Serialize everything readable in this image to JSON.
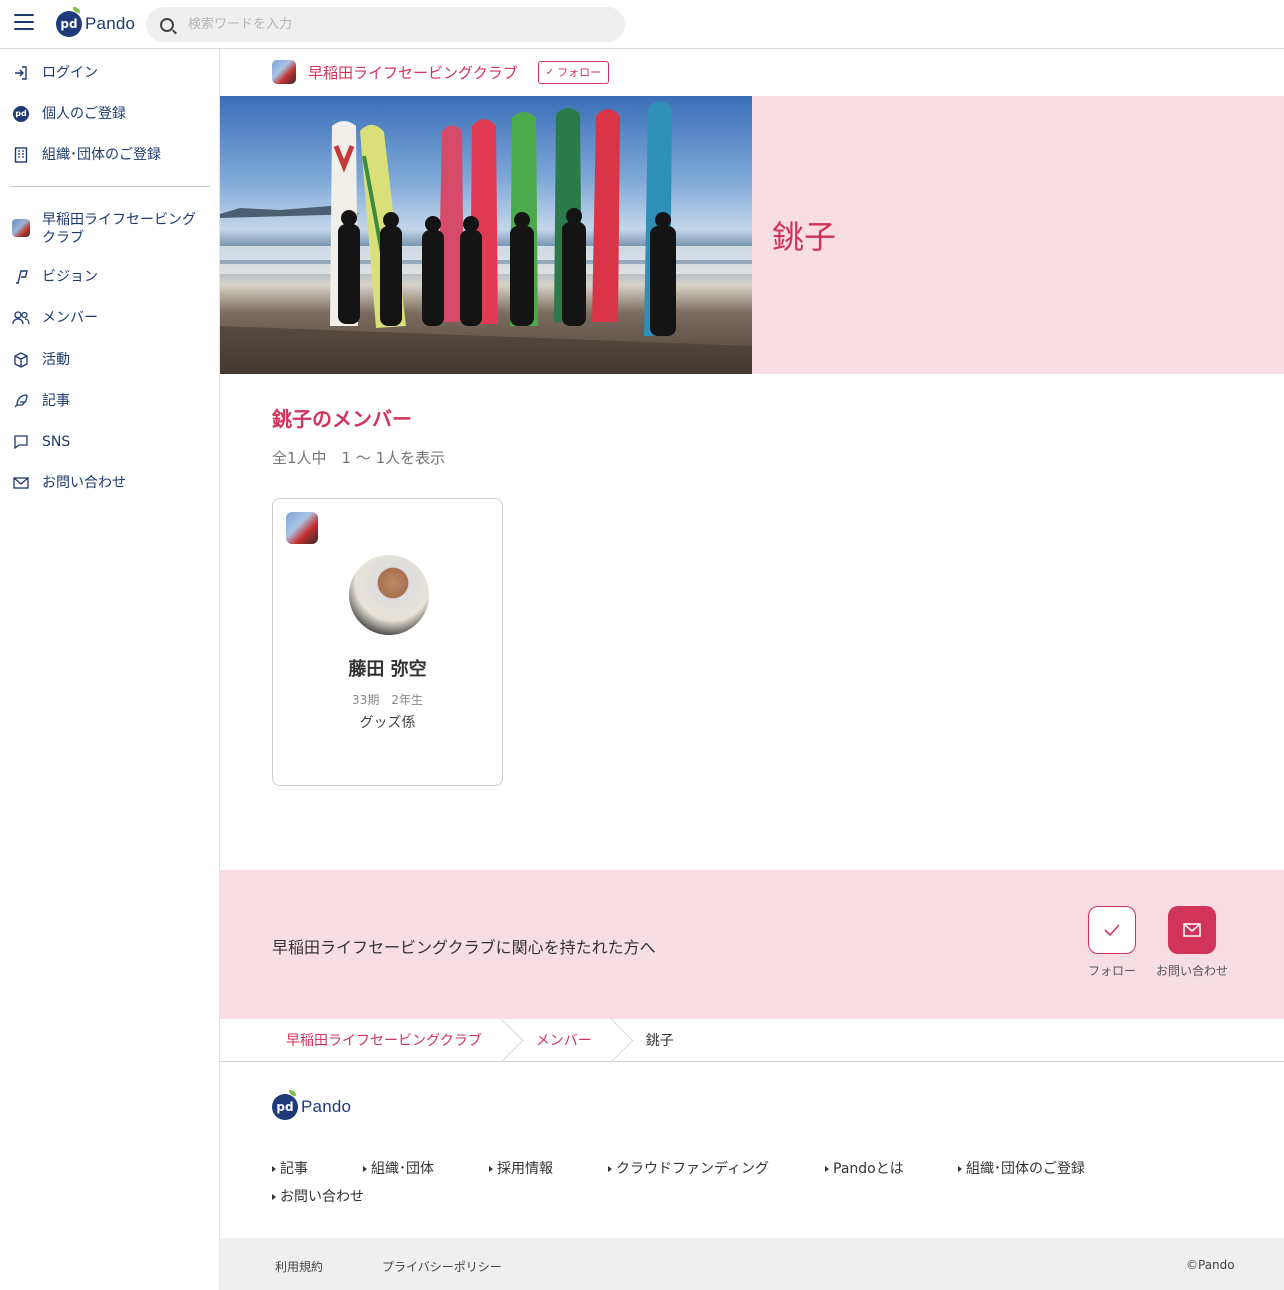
{
  "header": {
    "logo_text": "Pando",
    "logo_mark": "pd",
    "search_placeholder": "検索ワードを入力"
  },
  "sidebar": {
    "top_items": [
      {
        "label": "ログイン",
        "icon": "login-icon"
      },
      {
        "label": "個人のご登録",
        "icon": "pando-icon"
      },
      {
        "label": "組織･団体のご登録",
        "icon": "building-icon"
      }
    ],
    "org_item": {
      "label": "早稲田ライフセービングクラブ",
      "icon": "org-avatar"
    },
    "nav_items": [
      {
        "label": "ビジョン",
        "icon": "vision-icon"
      },
      {
        "label": "メンバー",
        "icon": "members-icon"
      },
      {
        "label": "活動",
        "icon": "box-icon"
      },
      {
        "label": "記事",
        "icon": "feather-icon"
      },
      {
        "label": "SNS",
        "icon": "chat-icon"
      },
      {
        "label": "お問い合わせ",
        "icon": "mail-icon"
      }
    ]
  },
  "org_bar": {
    "name": "早稲田ライフセービングクラブ",
    "follow_label": "フォロー"
  },
  "hero": {
    "title": "銚子"
  },
  "members": {
    "title": "銚子のメンバー",
    "count_text": "全1人中　1 〜 1人を表示",
    "cards": [
      {
        "name": "藤田 弥空",
        "meta": "33期　2年生",
        "role": "グッズ係"
      }
    ]
  },
  "cta": {
    "text": "早稲田ライフセービングクラブに関心を持たれた方へ",
    "follow_label": "フォロー",
    "contact_label": "お問い合わせ"
  },
  "breadcrumb": {
    "items": [
      "早稲田ライフセービングクラブ",
      "メンバー"
    ],
    "current": "銚子"
  },
  "footer": {
    "logo_text": "Pando",
    "links": [
      "記事",
      "組織･団体",
      "採用情報",
      "クラウドファンディング",
      "Pandoとは",
      "組織･団体のご登録",
      "お問い合わせ"
    ],
    "terms": "利用規約",
    "privacy": "プライバシーポリシー",
    "copyright": "©Pando"
  },
  "colors": {
    "accent": "#d2335a",
    "navy": "#1d3a6e",
    "pink_bg": "#f8dde4"
  }
}
